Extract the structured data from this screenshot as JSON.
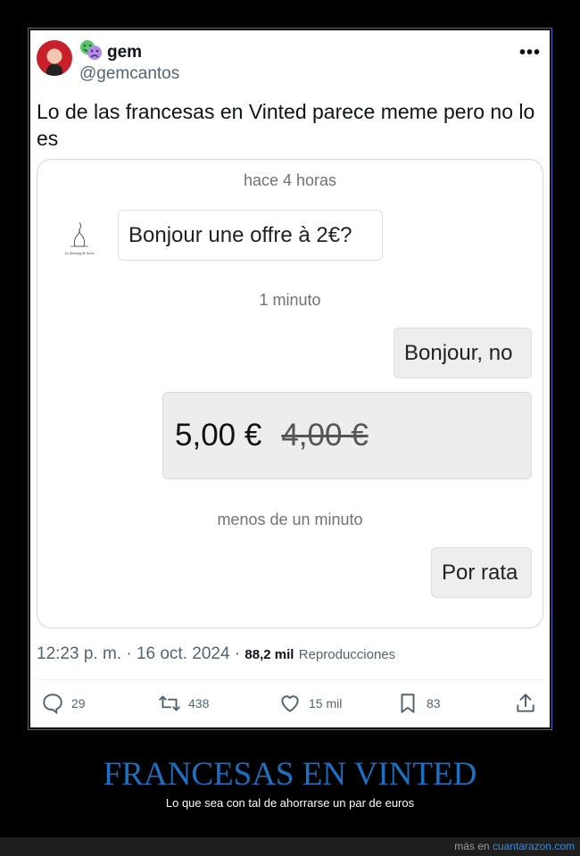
{
  "tweet": {
    "display_name": "gem",
    "handle": "@gemcantos",
    "text": "Lo de las francesas en Vinted parece meme pero no lo es",
    "time": "12:23 p. m. · 16 oct. 2024 ·",
    "views_count": "88,2 mil",
    "views_label": "Reproducciones",
    "more_icon": "•••"
  },
  "chat": {
    "timestamp_1": "hace 4 horas",
    "message_1": "Bonjour une offre à 2€?",
    "shop_logo_text": "La dressing de Sofia",
    "timestamp_2": "1 minuto",
    "message_2": "Bonjour, no",
    "offer_price": "5,00 €",
    "original_price": "4,00 €",
    "timestamp_3": "menos de un minuto",
    "message_3": "Por rata"
  },
  "actions": {
    "replies": "29",
    "retweets": "438",
    "likes": "15 mil",
    "bookmarks": "83"
  },
  "meme": {
    "title": "FRANCESAS EN VINTED",
    "subtitle": "Lo que sea con tal de ahorrarse un par de euros",
    "footer_prefix": "más en",
    "footer_site": "cuantarazon.com"
  },
  "colors": {
    "frame_border": "#4a64c8",
    "title": "#1d6fc2",
    "link": "#3b8bd9"
  }
}
